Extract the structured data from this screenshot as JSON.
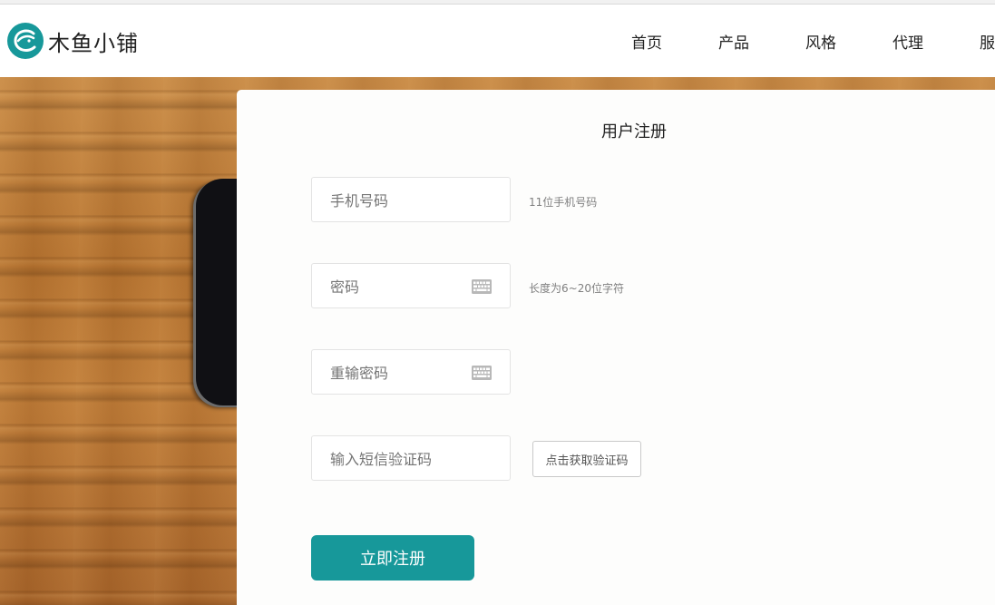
{
  "header": {
    "logo_text": "木鱼小铺",
    "nav": [
      "首页",
      "产品",
      "风格",
      "代理",
      "服务"
    ]
  },
  "form": {
    "title": "用户注册",
    "phone_placeholder": "手机号码",
    "phone_hint": "11位手机号码",
    "password_placeholder": "密码",
    "password_hint": "长度为6~20位字符",
    "confirm_placeholder": "重输密码",
    "sms_placeholder": "输入短信验证码",
    "get_code_label": "点击获取验证码",
    "submit_label": "立即注册"
  },
  "colors": {
    "brand": "#17989a",
    "wood": "#b87430"
  },
  "icons": {
    "logo": "fish-logo-icon",
    "password_keyboard": "keyboard-icon",
    "confirm_keyboard": "keyboard-icon"
  }
}
